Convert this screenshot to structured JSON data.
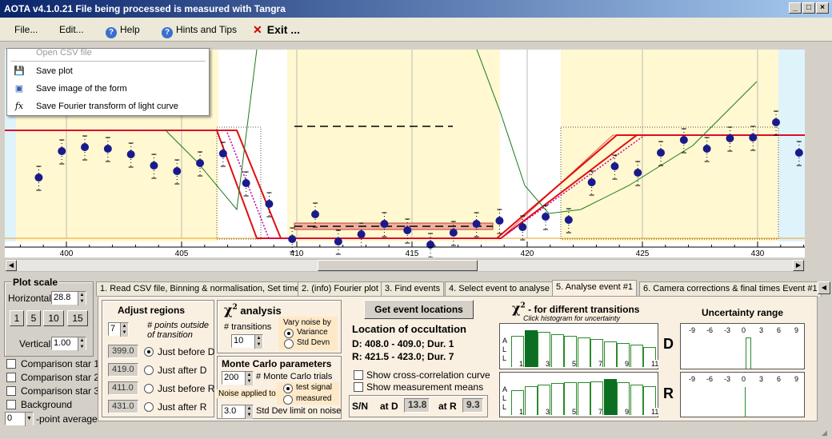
{
  "window": {
    "title": "AOTA v4.1.0.21   File being processed is measured with Tangra"
  },
  "menu": {
    "file": "File...",
    "edit": "Edit...",
    "help": "Help",
    "hints": "Hints and Tips",
    "exit": "Exit ..."
  },
  "dropdown": {
    "items": [
      "Open CSV file",
      "Save plot",
      "Save image of the form",
      "Save Fourier transform of light curve"
    ]
  },
  "plot": {
    "x_ticks": [
      "400",
      "405",
      "410",
      "415",
      "420",
      "425",
      "430"
    ],
    "points": [
      [
        398.8,
        160
      ],
      [
        399.8,
        127
      ],
      [
        400.8,
        122
      ],
      [
        401.8,
        124
      ],
      [
        402.8,
        131
      ],
      [
        403.8,
        145
      ],
      [
        404.8,
        152
      ],
      [
        405.8,
        142
      ],
      [
        406.8,
        130
      ],
      [
        407.8,
        167
      ],
      [
        408.8,
        193
      ],
      [
        409.8,
        237
      ],
      [
        410.8,
        206
      ],
      [
        411.8,
        240
      ],
      [
        412.8,
        231
      ],
      [
        413.8,
        218
      ],
      [
        414.8,
        226
      ],
      [
        415.8,
        244
      ],
      [
        416.8,
        229
      ],
      [
        417.8,
        218
      ],
      [
        418.8,
        214
      ],
      [
        419.8,
        222
      ],
      [
        420.8,
        209
      ],
      [
        421.8,
        213
      ],
      [
        422.8,
        166
      ],
      [
        423.8,
        146
      ],
      [
        424.8,
        154
      ],
      [
        425.8,
        129
      ],
      [
        426.8,
        113
      ],
      [
        427.8,
        124
      ],
      [
        428.8,
        111
      ],
      [
        429.8,
        110
      ],
      [
        430.8,
        91
      ],
      [
        431.8,
        129
      ],
      [
        432.8,
        166
      ]
    ]
  },
  "plot_scale": {
    "title": "Plot scale",
    "horizontal_label": "Horizontal",
    "horizontal": "28.8",
    "buttons": [
      "1",
      "5",
      "10",
      "15"
    ],
    "vertical_label": "Vertical",
    "vertical": "1.00"
  },
  "comparison": {
    "items": [
      "Comparison star 1",
      "Comparison star 2",
      "Comparison star 3",
      "Background"
    ],
    "point_avg_value": "0",
    "point_avg_label": "-point average"
  },
  "tabs": [
    "1.  Read CSV file, Binning & normalisation, Set time",
    "2. (info)  Fourier plot",
    "3. Find events",
    "4. Select event to analyse",
    "5. Analyse event #1",
    "6. Camera corrections & final times Event #1"
  ],
  "adjust": {
    "title": "Adjust regions",
    "points_value": "7",
    "points_label": "# points outside of transition",
    "rows": [
      {
        "value": "399.0",
        "label": "Just before D"
      },
      {
        "value": "419.0",
        "label": "Just after D"
      },
      {
        "value": "411.0",
        "label": "Just before R"
      },
      {
        "value": "431.0",
        "label": "Just after R"
      }
    ]
  },
  "chi": {
    "title": "analysis",
    "transitions_label": "# transitions",
    "transitions_value": "10",
    "vary_title": "Vary noise by",
    "variance": "Variance",
    "std_devn": "Std Devn"
  },
  "monte": {
    "title": "Monte Carlo parameters",
    "trials_value": "200",
    "trials_label": "# Monte Carlo trials",
    "noise_applied": "Noise applied to",
    "test_signal": "test signal",
    "measured": "measured",
    "std_limit_value": "3.0",
    "std_limit_label": "Std Dev limit on noise"
  },
  "locations": {
    "button": "Get event locations",
    "title": "Location of occultation",
    "d": "D: 408.0 - 409.0; Dur. 1",
    "r": "R: 421.5 - 423.0; Dur. 7",
    "cross": "Show cross-correlation curve",
    "means": "Show measurement means",
    "sn": "S/N",
    "at_d": "at D",
    "d_val": "13.8",
    "at_r": "at R",
    "r_val": "9.3"
  },
  "hist": {
    "title": "- for different transitions",
    "subtitle": "Click histogram for uncertainty",
    "side": "A L L",
    "ticks": [
      "1",
      "3",
      "5",
      "7",
      "9",
      "11"
    ],
    "d_bars": [
      0.85,
      1.0,
      0.95,
      0.9,
      0.85,
      0.8,
      0.75,
      0.7,
      0.65,
      0.6,
      0.55
    ],
    "r_bars": [
      0.7,
      0.8,
      0.85,
      0.88,
      0.9,
      0.92,
      0.93,
      1.0,
      0.9,
      0.85,
      0.8
    ],
    "d_sel": 1,
    "r_sel": 7
  },
  "uncertainty": {
    "title": "Uncertainty range",
    "ticks": [
      "-9",
      "-6",
      "-3",
      "0",
      "3",
      "6",
      "9"
    ],
    "d_label": "D",
    "r_label": "R"
  }
}
